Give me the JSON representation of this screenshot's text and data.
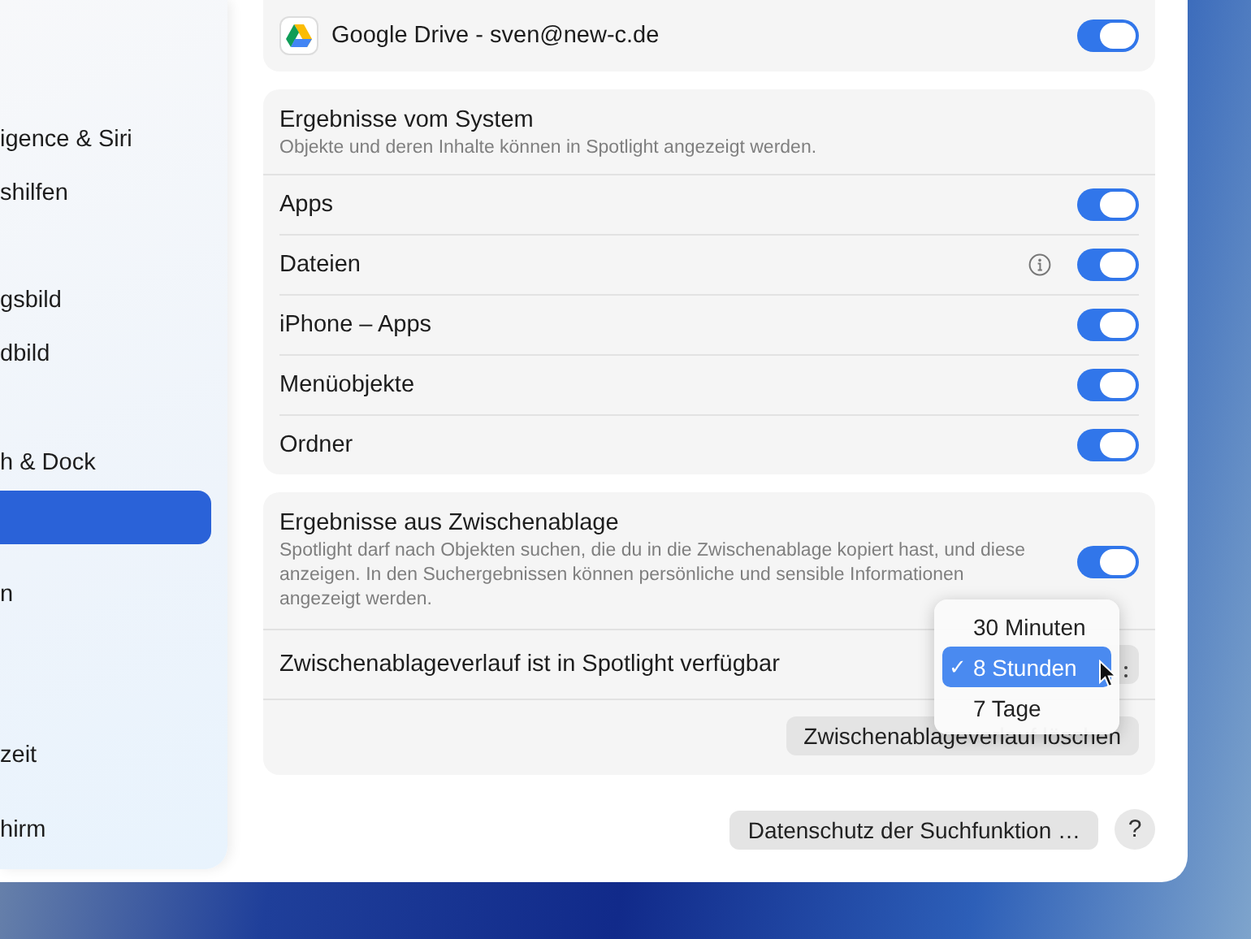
{
  "sidebar": {
    "groups": [
      [
        {
          "label": "igence & Siri",
          "selected": false
        },
        {
          "label": "shilfen",
          "selected": false
        }
      ],
      [
        {
          "label": "gsbild",
          "selected": false
        },
        {
          "label": "dbild",
          "selected": false
        }
      ],
      [
        {
          "label": "h & Dock",
          "selected": false
        },
        {
          "selected": true
        }
      ],
      [
        {
          "label": "n",
          "selected": false
        }
      ],
      [
        {
          "label": "zeit",
          "selected": false
        }
      ],
      [
        {
          "label": "hirm",
          "selected": false
        }
      ]
    ]
  },
  "account_row": {
    "label": "Google Drive - sven@new-c.de",
    "on": true
  },
  "system_results": {
    "title": "Ergebnisse vom System",
    "description": "Objekte und deren Inhalte können in Spotlight angezeigt werden.",
    "items": [
      {
        "label": "Apps",
        "on": true,
        "info": false
      },
      {
        "label": "Dateien",
        "on": true,
        "info": true
      },
      {
        "label": "iPhone – Apps",
        "on": true,
        "info": false
      },
      {
        "label": "Menüobjekte",
        "on": true,
        "info": false
      },
      {
        "label": "Ordner",
        "on": true,
        "info": false
      }
    ]
  },
  "clipboard": {
    "title": "Ergebnisse aus Zwischenablage",
    "description": "Spotlight darf nach Objekten suchen, die du in die Zwischenablage kopiert hast, und diese anzeigen. In den Suchergebnissen können persönliche und sensible Informationen angezeigt werden.",
    "on": true,
    "history_label": "Zwischenablageverlauf ist in Spotlight verfügbar",
    "menu": [
      {
        "label": "30 Minuten",
        "selected": false
      },
      {
        "label": "8 Stunden",
        "selected": true
      },
      {
        "label": "7 Tage",
        "selected": false
      }
    ],
    "check_mark": "✓",
    "clear_button": "Zwischenablageverlauf löschen"
  },
  "footer": {
    "privacy_button": "Datenschutz der Suchfunktion …",
    "help_button": "?"
  }
}
